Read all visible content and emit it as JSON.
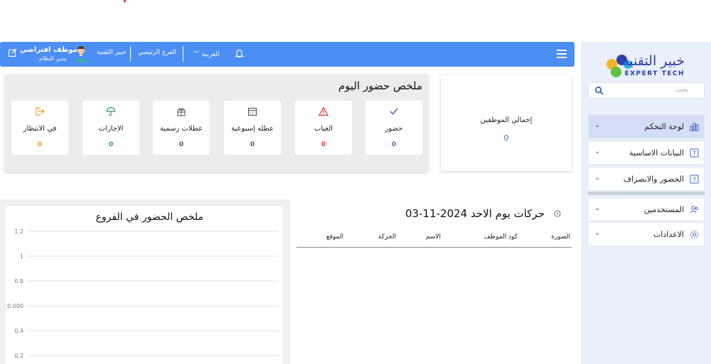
{
  "sidebar": {
    "logo": {
      "title": "خبير التقنية",
      "subtitle": "EXPERT TECH"
    },
    "search_placeholder": "بحث",
    "items": [
      {
        "label": "لوحة التحكم",
        "icon": "chart-icon",
        "active": true
      },
      {
        "label": "البيانات الاساسية",
        "icon": "help-icon"
      },
      {
        "label": "الحضور والانصراف",
        "icon": "help-icon"
      },
      {
        "label": "المستخدمين",
        "icon": "users-icon"
      },
      {
        "label": "الاعدادات",
        "icon": "gear-icon"
      }
    ]
  },
  "header": {
    "language": "العربية",
    "branch": "الفرع الرئيسي",
    "company": "خبير التقنية",
    "user_name": "موظف افتراضي",
    "user_role": "مدير النظام"
  },
  "summary": {
    "title": "ملخص حضور اليوم",
    "cards": [
      {
        "label": "حضور",
        "value": "0",
        "color": "#3f6fb5",
        "icon": "check-icon"
      },
      {
        "label": "الغياب",
        "value": "0",
        "color": "#e53935",
        "icon": "warning-icon"
      },
      {
        "label": "عطله إسبوعية",
        "value": "0",
        "color": "#555555",
        "icon": "calendar-icon"
      },
      {
        "label": "عطلات رسمية",
        "value": "0",
        "color": "#555555",
        "icon": "gift-icon"
      },
      {
        "label": "الاجازات",
        "value": "0",
        "color": "#2e9e5b",
        "icon": "umbrella-icon"
      },
      {
        "label": "في الانتظار",
        "value": "0",
        "color": "#f0a020",
        "icon": "exit-icon"
      }
    ]
  },
  "total_employees": {
    "label": "إجمالي الموظفين",
    "value": "0"
  },
  "movements": {
    "title": "حركات يوم الاحد 2024-11-03",
    "columns": [
      "الصورة",
      "كود الموظف",
      "الاسم",
      "الحركة",
      "الموقع"
    ]
  },
  "branch_chart": {
    "title": "ملخص الحضور في الفروع",
    "y_ticks": [
      "1.2",
      "1",
      "0.8",
      "0.600",
      "0.4",
      "0.2"
    ]
  },
  "chart_data": {
    "type": "bar",
    "title": "ملخص الحضور في الفروع",
    "categories": [],
    "values": [],
    "y_ticks": [
      1.2,
      1,
      0.8,
      0.6,
      0.4,
      0.2
    ],
    "grid": true
  }
}
